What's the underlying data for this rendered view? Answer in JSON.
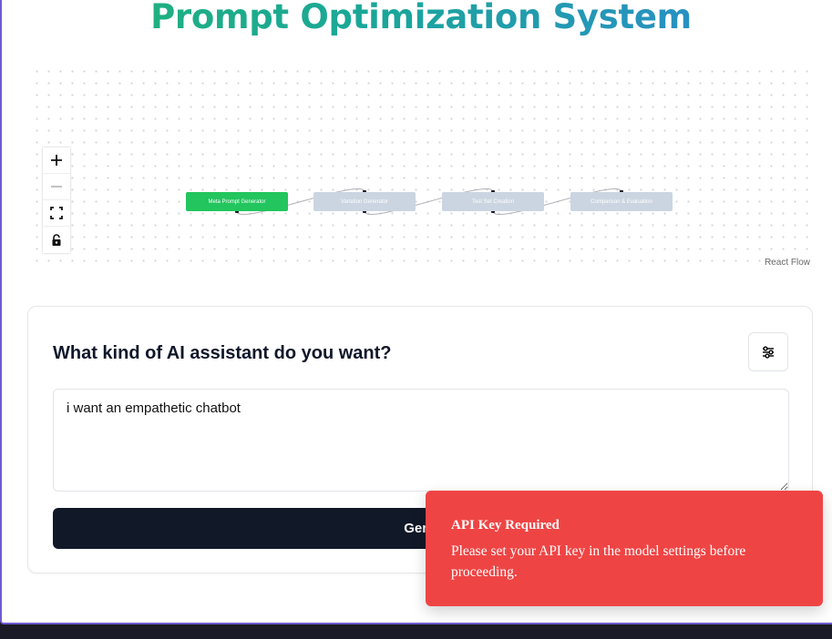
{
  "header": {
    "title": "Prompt Optimization System"
  },
  "flow": {
    "nodes": [
      {
        "label": "Meta Prompt Generator",
        "status": "active"
      },
      {
        "label": "Variation Generator",
        "status": "idle"
      },
      {
        "label": "Test Set Creation",
        "status": "idle"
      },
      {
        "label": "Comparison & Evaluation",
        "status": "idle"
      }
    ],
    "controls": [
      "zoom-in",
      "zoom-out",
      "fit-view",
      "toggle-interactivity"
    ],
    "attribution": "React Flow"
  },
  "form": {
    "heading": "What kind of AI assistant do you want?",
    "input_value": "i want an empathetic chatbot",
    "submit_label": "Gene"
  },
  "toast": {
    "title": "API Key Required",
    "description": "Please set your API key in the model settings before proceeding."
  },
  "colors": {
    "node_active": "#22c55e",
    "node_idle": "#cbd5e1",
    "button_dark": "#111827",
    "toast_bg": "#ef4444",
    "title_gradient_start": "#22b573",
    "title_gradient_end": "#2f86d6"
  }
}
